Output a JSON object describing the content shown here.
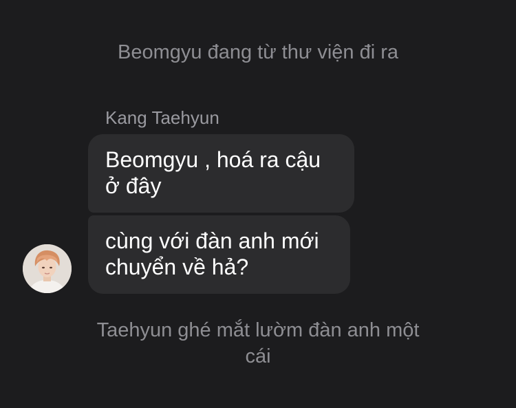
{
  "conversation": {
    "notes": {
      "top": "Beomgyu đang từ thư viện đi ra",
      "bottom": "Taehyun ghé mắt lườm đàn anh một cái"
    },
    "sender": {
      "name": "Kang Taehyun"
    },
    "messages": [
      {
        "lines": [
          "Beomgyu , hoá ra cậu",
          "ở đây"
        ]
      },
      {
        "lines": [
          "cùng với đàn anh mới",
          "chuyển về hả?"
        ]
      }
    ]
  },
  "colors": {
    "background": "#1c1c1e",
    "bubble": "#2c2c2e",
    "secondary_text": "#8e8e93",
    "primary_text": "#ffffff"
  }
}
